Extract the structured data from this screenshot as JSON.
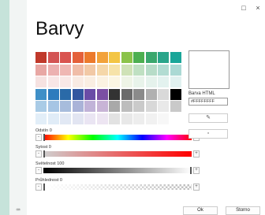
{
  "window": {
    "minimize_glyph": "□",
    "close_glyph": "×"
  },
  "title": "Barvy",
  "swatches": [
    [
      "#c0392b",
      "#d35454",
      "#d9534f",
      "#e4603a",
      "#ec7a2c",
      "#f2a23a",
      "#f3c544",
      "#8bc34a",
      "#4caf50",
      "#3aa76d",
      "#2aa58a",
      "#1aa699"
    ],
    [
      "#e8a7a4",
      "#ecb1b1",
      "#efb7b3",
      "#f0bda8",
      "#f2c9a6",
      "#f5d7a9",
      "#f6e3a9",
      "#cfe2b7",
      "#bfe0c2",
      "#b7dcc8",
      "#b2dcd2",
      "#abd9d4"
    ],
    [
      "#f6e2e1",
      "#f8e6e6",
      "#f9e8e6",
      "#f9ebe3",
      "#faeee2",
      "#fbf2e2",
      "#fbf6e3",
      "#eef4e6",
      "#e8f3ea",
      "#e5f2ec",
      "#e3f2ef",
      "#e1f1f0"
    ],
    [
      "#3f8fc7",
      "#2e7bbd",
      "#2a6aa8",
      "#3257a0",
      "#6a4ca6",
      "#7b4fa3",
      "#333333",
      "#6b6b6b",
      "#8a8a8a",
      "#b0b0b0",
      "#d9d9d9",
      "#000000"
    ],
    [
      "#a9cbe6",
      "#a6c5e4",
      "#a7bcdc",
      "#aab3d8",
      "#c1b3d8",
      "#c8b4d6",
      "#a9a9a9",
      "#bdbdbd",
      "#cacaca",
      "#d8d8d8",
      "#e9e9e9",
      "#c9c9c9"
    ],
    [
      "#e2eef8",
      "#e0ecf7",
      "#e1e8f4",
      "#e2e5f2",
      "#eae5f3",
      "#ede5f2",
      "#e2e2e2",
      "#e8e8e8",
      "#ededed",
      "#f1f1f1",
      "#f7f7f7",
      "#ffffff"
    ]
  ],
  "sliders": {
    "hue": {
      "label": "Odstín 0",
      "value": 0
    },
    "saturation": {
      "label": "Sytost 0",
      "value": 0
    },
    "brightness": {
      "label": "Světelnost 100",
      "value": 100
    },
    "transparency": {
      "label": "Průhlednost 0",
      "value": 0
    },
    "dec_glyph": "-",
    "inc_glyph": "+"
  },
  "preview_color": "#ffffff",
  "html_color": {
    "label": "Barva HTML",
    "value": "#FFFFFFFF"
  },
  "tools": {
    "eyedropper_icon": "eyedropper-icon",
    "eyedropper_glyph": "✎",
    "picker_icon": "color-picker-icon",
    "picker_glyph": "▫"
  },
  "footer": {
    "ok": "Ok",
    "cancel": "Storno",
    "keyboard_icon": "keyboard-icon",
    "keyboard_glyph": "⌨"
  }
}
